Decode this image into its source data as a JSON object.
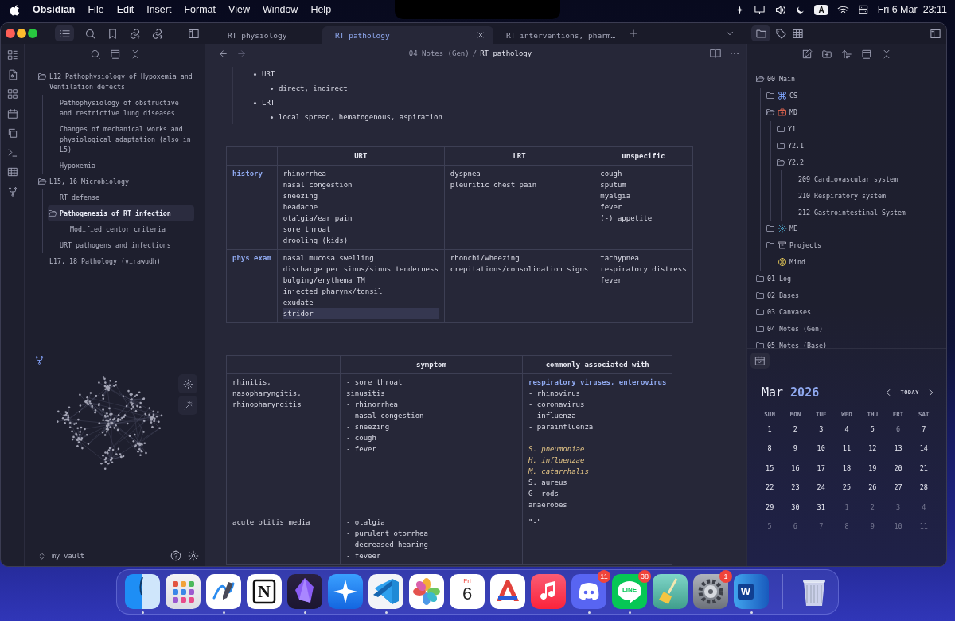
{
  "menubar": {
    "app": "Obsidian",
    "menus": [
      "File",
      "Edit",
      "Insert",
      "Format",
      "View",
      "Window",
      "Help"
    ],
    "input_source": "A",
    "date": "Fri 6 Mar",
    "time": "23:11"
  },
  "tabs": [
    {
      "title": "RT physiology",
      "selected": false
    },
    {
      "title": "RT pathology",
      "selected": true
    },
    {
      "title": "RT interventions, pharm…",
      "selected": false
    }
  ],
  "outline": [
    {
      "text": "L12 Pathophysiology of Hypoxemia and Ventilation defects",
      "selected": false,
      "children": [
        {
          "text": "Pathophysiology of obstructive and restrictive lung diseases",
          "selected": false
        },
        {
          "text": "Changes of mechanical works and physiological adaptation (also in L5)",
          "selected": false
        },
        {
          "text": "Hypoxemia",
          "selected": false
        }
      ]
    },
    {
      "text": "L15, 16 Microbiology",
      "selected": false,
      "children": [
        {
          "text": "RT defense",
          "selected": false
        },
        {
          "text": "Pathogenesis of RT infection",
          "selected": true,
          "children": [
            {
              "text": "Modified centor criteria",
              "selected": false
            }
          ]
        },
        {
          "text": "URT pathogens and infections",
          "selected": false
        }
      ]
    },
    {
      "text": "L17, 18 Pathology (virawudh)",
      "selected": false
    }
  ],
  "vault": "my vault",
  "breadcrumb": {
    "folder": "04 Notes (Gen)",
    "separator": "/",
    "note": "RT pathology"
  },
  "bullets": [
    {
      "text": "URT",
      "children": [
        {
          "text": "direct, indirect"
        }
      ]
    },
    {
      "text": "LRT",
      "children": [
        {
          "text": "local spread, hematogenous, aspiration"
        }
      ]
    }
  ],
  "table_1": {
    "columns": [
      "URT",
      "LRT",
      "unspecific"
    ],
    "rows": [
      {
        "label": "history",
        "cells": [
          {
            "lines": [
              "rhinorrhea",
              "nasal congestion",
              "sneezing",
              "headache",
              "otalgia/ear pain",
              "sore throat",
              "drooling (kids)"
            ],
            "cursor": false
          },
          {
            "lines": [
              "dyspnea",
              "pleuritic chest pain"
            ],
            "cursor": false
          },
          {
            "lines": [
              "cough",
              "sputum",
              "myalgia",
              "fever",
              "(-) appetite"
            ],
            "cursor": false
          }
        ]
      },
      {
        "label": "phys exam",
        "cells": [
          {
            "lines": [
              "nasal mucosa swelling",
              "discharge per sinus/sinus tenderness",
              "bulging/erythema TM",
              "injected pharynx/tonsil",
              "exudate",
              "stridor"
            ],
            "cursor": true
          },
          {
            "lines": [
              "rhonchi/wheezing",
              "crepitations/consolidation signs"
            ],
            "cursor": false
          },
          {
            "lines": [
              "tachypnea",
              "respiratory distress",
              "fever"
            ],
            "cursor": false
          }
        ]
      }
    ]
  },
  "table_2": {
    "columns": [
      "symptom",
      "commonly associated with"
    ],
    "rows": [
      {
        "label": [
          "rhinitis,",
          "nasopharyngitis,",
          "rhinopharyngitis"
        ],
        "cells": [
          [
            "- sore throat",
            "sinusitis",
            "- rhinorrhea",
            "- nasal congestion",
            "- sneezing",
            "- cough",
            "- fever"
          ],
          [
            {
              "text": "respiratory viruses, enterovirus",
              "kind": "strong"
            },
            "- rhinovirus",
            "- coronavirus",
            "- influenza",
            "- parainfluenza",
            {
              "text": "S. pneumoniae",
              "kind": "emphasis",
              "gap_before": true
            },
            {
              "text": "H. influenzae",
              "kind": "emphasis"
            },
            {
              "text": "M. catarrhalis",
              "kind": "emphasis"
            },
            "S. aureus",
            "G- rods",
            "anaerobes"
          ]
        ]
      },
      {
        "label": [
          "acute otitis media"
        ],
        "cells": [
          [
            "- otalgia",
            "- purulent otorrhea",
            "- decreased hearing",
            "- feveer"
          ],
          [
            "\"-\""
          ]
        ]
      }
    ]
  },
  "file_tree": [
    {
      "name": "00 Main",
      "kind": "folder",
      "expanded": true,
      "children": [
        {
          "name": "CS",
          "kind": "folder_command",
          "expanded": false
        },
        {
          "name": "MD",
          "kind": "folder_medkit",
          "expanded": true,
          "children": [
            {
              "name": "Y1",
              "kind": "folder",
              "expanded": false
            },
            {
              "name": "Y2.1",
              "kind": "folder",
              "expanded": false
            },
            {
              "name": "Y2.2",
              "kind": "folder",
              "expanded": true,
              "children": [
                {
                  "name": "209 Cardiovascular system",
                  "kind": "note"
                },
                {
                  "name": "210 Respiratory system",
                  "kind": "note"
                },
                {
                  "name": "212 Gastrointestinal System",
                  "kind": "note"
                }
              ]
            }
          ]
        },
        {
          "name": "ME",
          "kind": "folder_gear",
          "expanded": false
        },
        {
          "name": "Projects",
          "kind": "folder_archive",
          "expanded": false
        },
        {
          "name": "Mind",
          "kind": "note_brain"
        }
      ]
    },
    {
      "name": "01 Log",
      "kind": "folder",
      "expanded": false
    },
    {
      "name": "02 Bases",
      "kind": "folder",
      "expanded": false
    },
    {
      "name": "03 Canvases",
      "kind": "folder",
      "expanded": false
    },
    {
      "name": "04 Notes (Gen)",
      "kind": "folder",
      "expanded": false
    },
    {
      "name": "05 Notes (Base)",
      "kind": "folder",
      "expanded": false
    }
  ],
  "calendar": {
    "month": "Mar",
    "year": "2026",
    "today_button": "TODAY",
    "weekdays": [
      "SUN",
      "MON",
      "TUE",
      "WED",
      "THU",
      "FRI",
      "SAT"
    ],
    "weeks": [
      [
        {
          "n": "1",
          "muted": false,
          "today": false
        },
        {
          "n": "2",
          "muted": false,
          "today": false
        },
        {
          "n": "3",
          "muted": false,
          "today": false
        },
        {
          "n": "4",
          "muted": false,
          "today": false
        },
        {
          "n": "5",
          "muted": false,
          "today": false
        },
        {
          "n": "6",
          "muted": false,
          "today": true
        },
        {
          "n": "7",
          "muted": false,
          "today": false
        }
      ],
      [
        {
          "n": "8",
          "muted": false,
          "today": false
        },
        {
          "n": "9",
          "muted": false,
          "today": false
        },
        {
          "n": "10",
          "muted": false,
          "today": false
        },
        {
          "n": "11",
          "muted": false,
          "today": false
        },
        {
          "n": "12",
          "muted": false,
          "today": false
        },
        {
          "n": "13",
          "muted": false,
          "today": false
        },
        {
          "n": "14",
          "muted": false,
          "today": false
        }
      ],
      [
        {
          "n": "15",
          "muted": false,
          "today": false
        },
        {
          "n": "16",
          "muted": false,
          "today": false
        },
        {
          "n": "17",
          "muted": false,
          "today": false
        },
        {
          "n": "18",
          "muted": false,
          "today": false
        },
        {
          "n": "19",
          "muted": false,
          "today": false
        },
        {
          "n": "20",
          "muted": false,
          "today": false
        },
        {
          "n": "21",
          "muted": false,
          "today": false
        }
      ],
      [
        {
          "n": "22",
          "muted": false,
          "today": false
        },
        {
          "n": "23",
          "muted": false,
          "today": false
        },
        {
          "n": "24",
          "muted": false,
          "today": false
        },
        {
          "n": "25",
          "muted": false,
          "today": false
        },
        {
          "n": "26",
          "muted": false,
          "today": false
        },
        {
          "n": "27",
          "muted": false,
          "today": false
        },
        {
          "n": "28",
          "muted": false,
          "today": false
        }
      ],
      [
        {
          "n": "29",
          "muted": false,
          "today": false
        },
        {
          "n": "30",
          "muted": false,
          "today": false
        },
        {
          "n": "31",
          "muted": false,
          "today": false
        },
        {
          "n": "1",
          "muted": true,
          "today": false
        },
        {
          "n": "2",
          "muted": true,
          "today": false
        },
        {
          "n": "3",
          "muted": true,
          "today": false
        },
        {
          "n": "4",
          "muted": true,
          "today": false
        }
      ],
      [
        {
          "n": "5",
          "muted": true,
          "today": false
        },
        {
          "n": "6",
          "muted": true,
          "today": false
        },
        {
          "n": "7",
          "muted": true,
          "today": false
        },
        {
          "n": "8",
          "muted": true,
          "today": false
        },
        {
          "n": "9",
          "muted": true,
          "today": false
        },
        {
          "n": "10",
          "muted": true,
          "today": false
        },
        {
          "n": "11",
          "muted": true,
          "today": false
        }
      ]
    ]
  },
  "dock": [
    {
      "kind": "finder",
      "running": true
    },
    {
      "kind": "launchpad",
      "running": false
    },
    {
      "kind": "freeform",
      "running": true
    },
    {
      "kind": "notion",
      "running": false,
      "label": "N"
    },
    {
      "kind": "gem",
      "running": true
    },
    {
      "kind": "star",
      "running": false
    },
    {
      "kind": "code",
      "running": true
    },
    {
      "kind": "photos",
      "running": false
    },
    {
      "kind": "calendar",
      "running": false,
      "label": "Fri",
      "day": "6"
    },
    {
      "kind": "stripes",
      "running": false
    },
    {
      "kind": "music",
      "running": false
    },
    {
      "kind": "chat",
      "running": true,
      "badge": "11"
    },
    {
      "kind": "line",
      "running": true,
      "label": "LINE",
      "badge": "38"
    },
    {
      "kind": "broom",
      "running": false
    },
    {
      "kind": "settings",
      "running": false,
      "badge": "1"
    },
    {
      "kind": "word",
      "running": true,
      "label": "W"
    },
    {
      "kind": "trash",
      "running": false
    }
  ]
}
